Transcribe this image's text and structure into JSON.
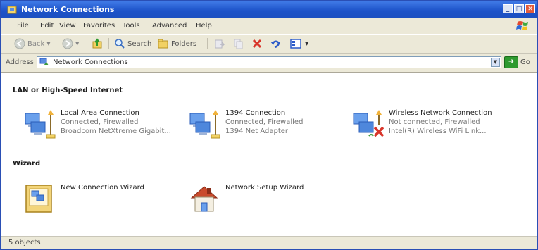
{
  "window": {
    "title": "Network Connections"
  },
  "menubar": {
    "items": [
      "File",
      "Edit",
      "View",
      "Favorites",
      "Tools",
      "Advanced",
      "Help"
    ]
  },
  "toolbar": {
    "back": "Back",
    "search": "Search",
    "folders": "Folders"
  },
  "address": {
    "label": "Address",
    "value": "Network Connections",
    "go": "Go"
  },
  "groups": [
    {
      "title": "LAN or High-Speed Internet",
      "items": [
        {
          "name": "Local Area Connection",
          "status": "Connected, Firewalled",
          "device": "Broadcom NetXtreme Gigabit..."
        },
        {
          "name": "1394 Connection",
          "status": "Connected, Firewalled",
          "device": "1394 Net Adapter"
        },
        {
          "name": "Wireless Network Connection",
          "status": "Not connected, Firewalled",
          "device": "Intel(R) Wireless WiFi Link..."
        }
      ]
    },
    {
      "title": "Wizard",
      "items": [
        {
          "name": "New Connection Wizard"
        },
        {
          "name": "Network Setup Wizard"
        }
      ]
    }
  ],
  "statusbar": {
    "text": "5 objects"
  },
  "colors": {
    "titlebar": "#1d53c9",
    "frame": "#ece9d8",
    "accent": "#2a4fb5"
  }
}
